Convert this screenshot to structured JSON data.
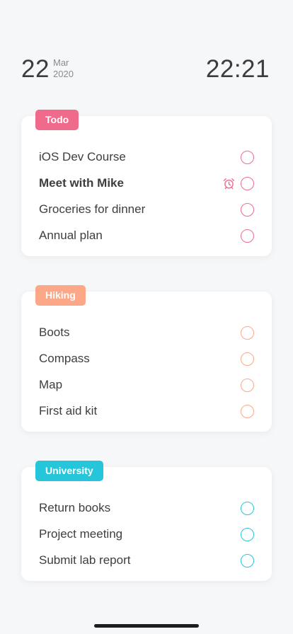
{
  "header": {
    "day": "22",
    "month": "Mar",
    "year": "2020",
    "time": "22:21"
  },
  "lists": [
    {
      "tag": "Todo",
      "color": "#f06a8b",
      "items": [
        {
          "label": "iOS Dev Course",
          "alarm": false,
          "bold": false
        },
        {
          "label": "Meet with Mike",
          "alarm": true,
          "bold": true
        },
        {
          "label": "Groceries for dinner",
          "alarm": false,
          "bold": false
        },
        {
          "label": "Annual plan",
          "alarm": false,
          "bold": false
        }
      ]
    },
    {
      "tag": "Hiking",
      "color": "#fca888",
      "items": [
        {
          "label": "Boots",
          "alarm": false,
          "bold": false
        },
        {
          "label": "Compass",
          "alarm": false,
          "bold": false
        },
        {
          "label": "Map",
          "alarm": false,
          "bold": false
        },
        {
          "label": "First aid kit",
          "alarm": false,
          "bold": false
        }
      ]
    },
    {
      "tag": "University",
      "color": "#25c6d9",
      "items": [
        {
          "label": "Return books",
          "alarm": false,
          "bold": false
        },
        {
          "label": "Project meeting",
          "alarm": false,
          "bold": false
        },
        {
          "label": "Submit lab report",
          "alarm": false,
          "bold": false
        }
      ]
    }
  ],
  "icons": {
    "alarm": "alarm-clock-icon",
    "check": "circle-check-icon"
  }
}
